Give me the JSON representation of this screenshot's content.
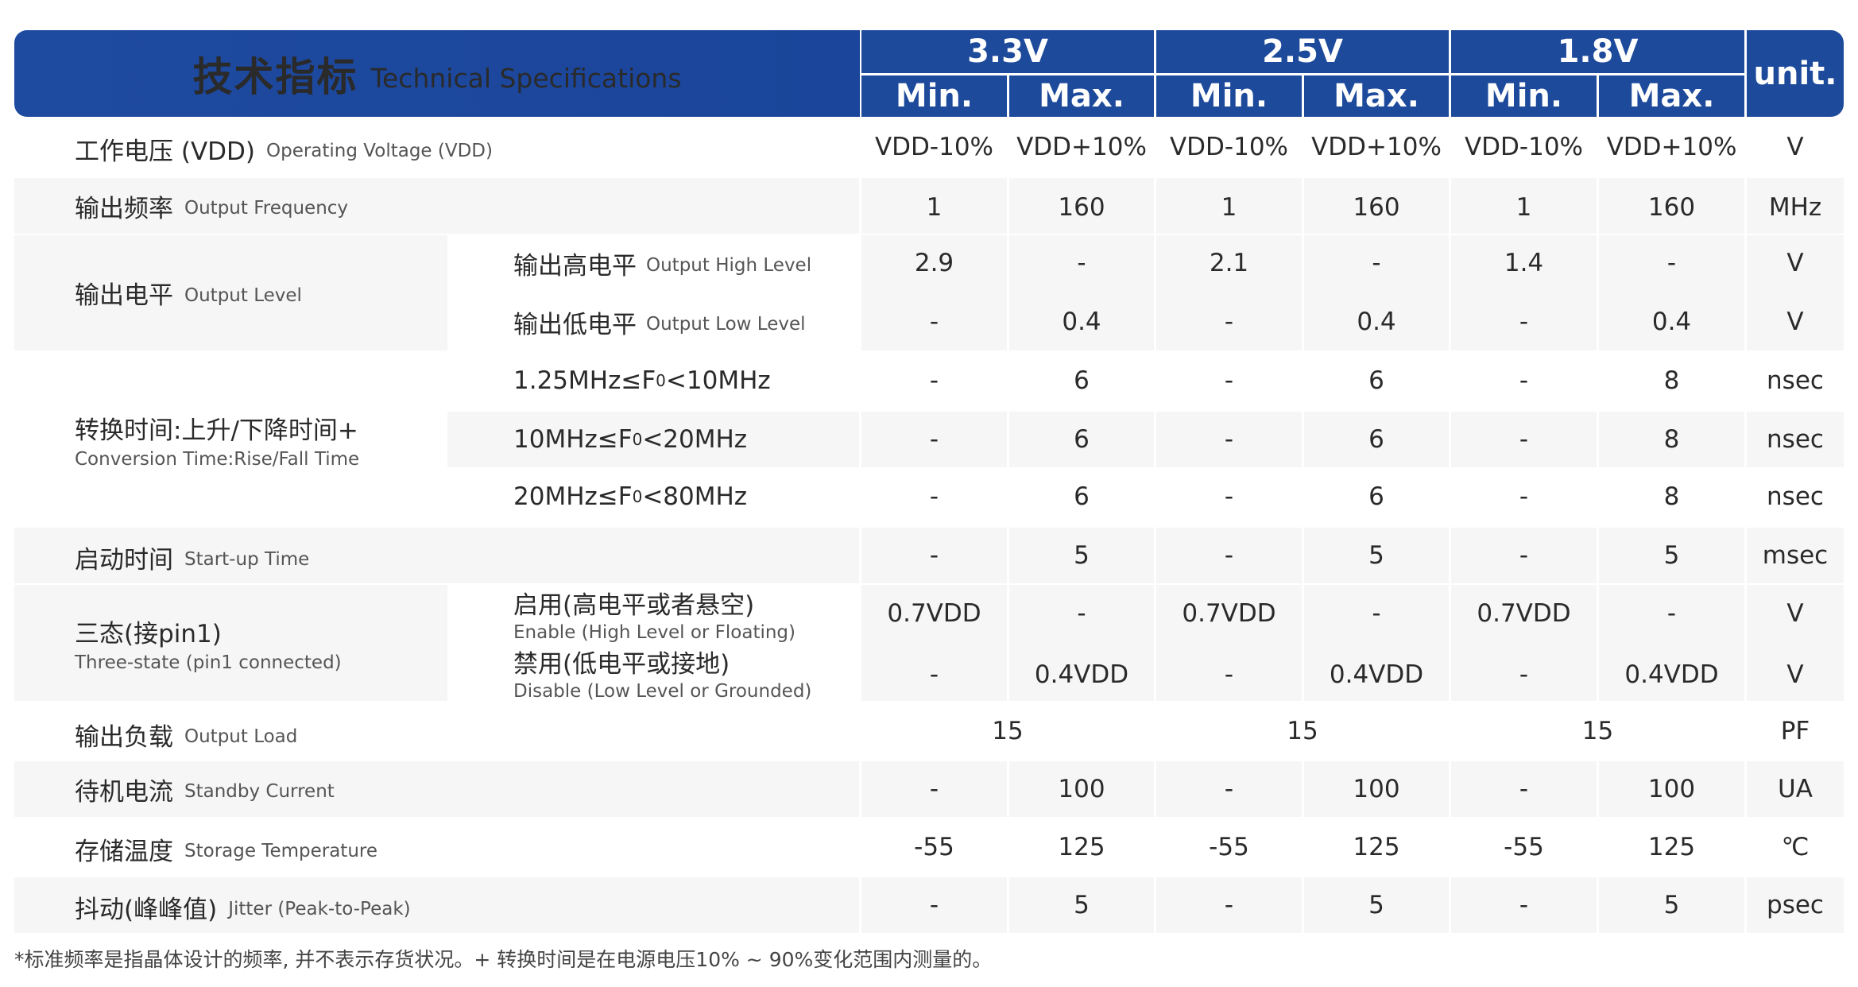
{
  "header": {
    "title_zh": "技术指标",
    "title_en": "Technical Specifications",
    "voltages": [
      "3.3V",
      "2.5V",
      "1.8V"
    ],
    "min_label": "Min.",
    "max_label": "Max.",
    "unit_label": "unit."
  },
  "rows": {
    "vdd": {
      "label_zh": "工作电压 (VDD)",
      "label_en": "Operating Voltage (VDD)",
      "values": [
        "VDD-10%",
        "VDD+10%",
        "VDD-10%",
        "VDD+10%",
        "VDD-10%",
        "VDD+10%"
      ],
      "unit": "V"
    },
    "freq": {
      "label_zh": "输出频率",
      "label_en": "Output Frequency",
      "values": [
        "1",
        "160",
        "1",
        "160",
        "1",
        "160"
      ],
      "unit": "MHz"
    },
    "level": {
      "label_zh": "输出电平",
      "label_en": "Output Level",
      "high": {
        "label_zh": "输出高电平",
        "label_en": "Output High Level",
        "values": [
          "2.9",
          "-",
          "2.1",
          "-",
          "1.4",
          "-"
        ],
        "unit": "V"
      },
      "low": {
        "label_zh": "输出低电平",
        "label_en": "Output Low Level",
        "values": [
          "-",
          "0.4",
          "-",
          "0.4",
          "-",
          "0.4"
        ],
        "unit": "V"
      }
    },
    "conv": {
      "label_zh": "转换时间:上升/下降时间+",
      "label_en": "Conversion Time:Rise/Fall Time",
      "sub": [
        {
          "label_a": "1.25MHz≤F",
          "label_sub": "0",
          "label_b": "<10MHz",
          "values": [
            "-",
            "6",
            "-",
            "6",
            "-",
            "8"
          ],
          "unit": "nsec"
        },
        {
          "label_a": "10MHz≤F",
          "label_sub": "0",
          "label_b": "<20MHz",
          "values": [
            "-",
            "6",
            "-",
            "6",
            "-",
            "8"
          ],
          "unit": "nsec"
        },
        {
          "label_a": "20MHz≤F",
          "label_sub": "0",
          "label_b": "<80MHz",
          "values": [
            "-",
            "6",
            "-",
            "6",
            "-",
            "8"
          ],
          "unit": "nsec"
        }
      ]
    },
    "startup": {
      "label_zh": "启动时间",
      "label_en": "Start-up Time",
      "values": [
        "-",
        "5",
        "-",
        "5",
        "-",
        "5"
      ],
      "unit": "msec"
    },
    "tristate": {
      "label_zh": "三态(接pin1)",
      "label_en": "Three-state (pin1 connected)",
      "enable": {
        "label_zh": "启用(高电平或者悬空)",
        "label_en": "Enable (High Level or Floating)",
        "values": [
          "0.7VDD",
          "-",
          "0.7VDD",
          "-",
          "0.7VDD",
          "-"
        ],
        "unit": "V"
      },
      "disable": {
        "label_zh": "禁用(低电平或接地)",
        "label_en": "Disable (Low Level or Grounded)",
        "values": [
          "-",
          "0.4VDD",
          "-",
          "0.4VDD",
          "-",
          "0.4VDD"
        ],
        "unit": "V"
      }
    },
    "load": {
      "label_zh": "输出负载",
      "label_en": "Output Load",
      "values": [
        "15",
        "15",
        "15"
      ],
      "unit": "PF"
    },
    "standby": {
      "label_zh": "待机电流",
      "label_en": "Standby Current",
      "values": [
        "-",
        "100",
        "-",
        "100",
        "-",
        "100"
      ],
      "unit": "UA"
    },
    "storage": {
      "label_zh": "存储温度",
      "label_en": "Storage Temperature",
      "values": [
        "-55",
        "125",
        "-55",
        "125",
        "-55",
        "125"
      ],
      "unit": "℃"
    },
    "jitter": {
      "label_zh": "抖动(峰峰值)",
      "label_en": "Jitter (Peak-to-Peak)",
      "values": [
        "-",
        "5",
        "-",
        "5",
        "-",
        "5"
      ],
      "unit": "psec"
    }
  },
  "footnote": "*标准频率是指晶体设计的频率, 并不表示存货状况。+ 转换时间是在电源电压10% ~ 90%变化范围内测量的。"
}
